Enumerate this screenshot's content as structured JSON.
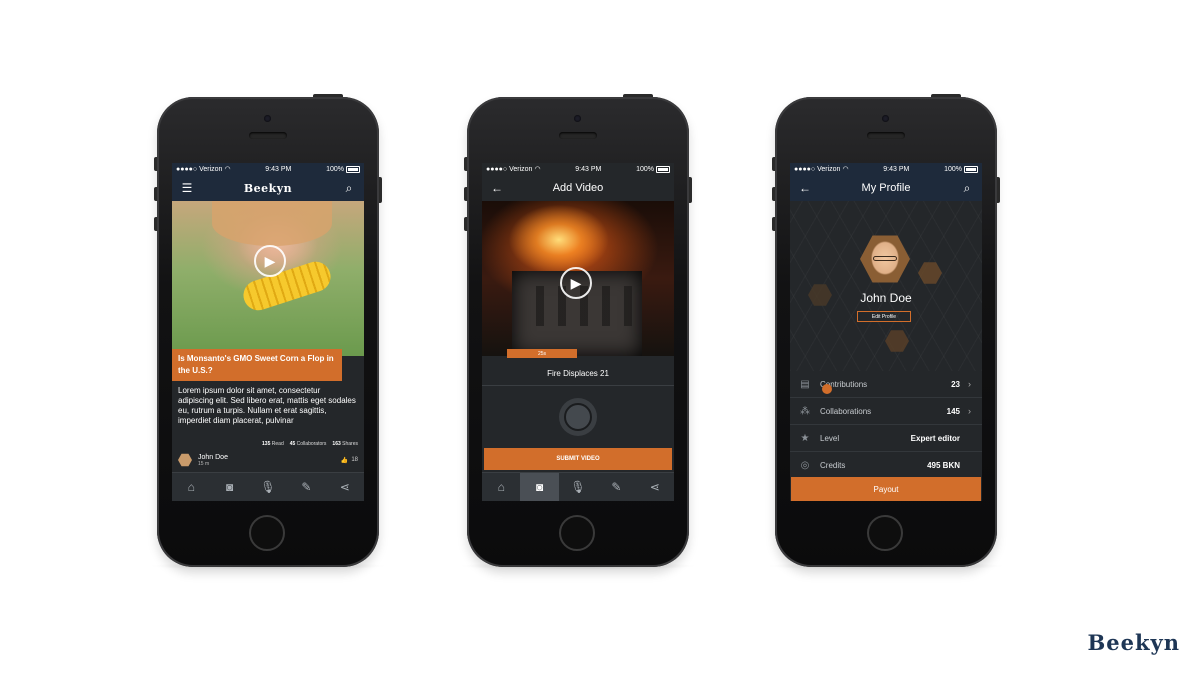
{
  "status": {
    "carrier": "●●●●○ Verizon",
    "time": "9:43 PM",
    "battery": "100%"
  },
  "phone1": {
    "title": "Beekyn",
    "headline": "Is Monsanto's GMO Sweet Corn a Flop in the U.S.?",
    "body": "Lorem ipsum dolor sit amet, consectetur adipiscing elit. Sed libero erat, mattis eget sodales eu, rutrum a turpis. Nullam et erat sagittis, imperdiet diam placerat, pulvinar",
    "stats": {
      "read": "135",
      "read_label": "Read",
      "collab": "45",
      "collab_label": "Collaborators",
      "shares": "163",
      "shares_label": "Shares"
    },
    "author": {
      "name": "John Doe",
      "time": "15 m"
    },
    "likes": "18"
  },
  "phone2": {
    "title": "Add Video",
    "timestamp": "25s",
    "caption": "Fire Displaces 21",
    "submit": "SUBMIT VIDEO"
  },
  "phone3": {
    "title": "My Profile",
    "name": "John Doe",
    "edit": "Edit Profile",
    "rows": [
      {
        "label": "Contributions",
        "value": "23",
        "icon": "list-icon"
      },
      {
        "label": "Collaborations",
        "value": "145",
        "icon": "circles-icon"
      },
      {
        "label": "Level",
        "value": "Expert editor",
        "icon": "star-icon"
      },
      {
        "label": "Credits",
        "value": "495 BKN",
        "icon": "coins-icon"
      }
    ],
    "payout": "Payout"
  },
  "tabs": [
    "home-icon",
    "camera-icon",
    "mic-icon",
    "pencil-icon",
    "share-icon"
  ],
  "brand": "Beekyn",
  "colors": {
    "accent": "#d26e2b",
    "navbar": "#1e2a3b",
    "screen": "#24272a",
    "brand": "#1e3655"
  }
}
